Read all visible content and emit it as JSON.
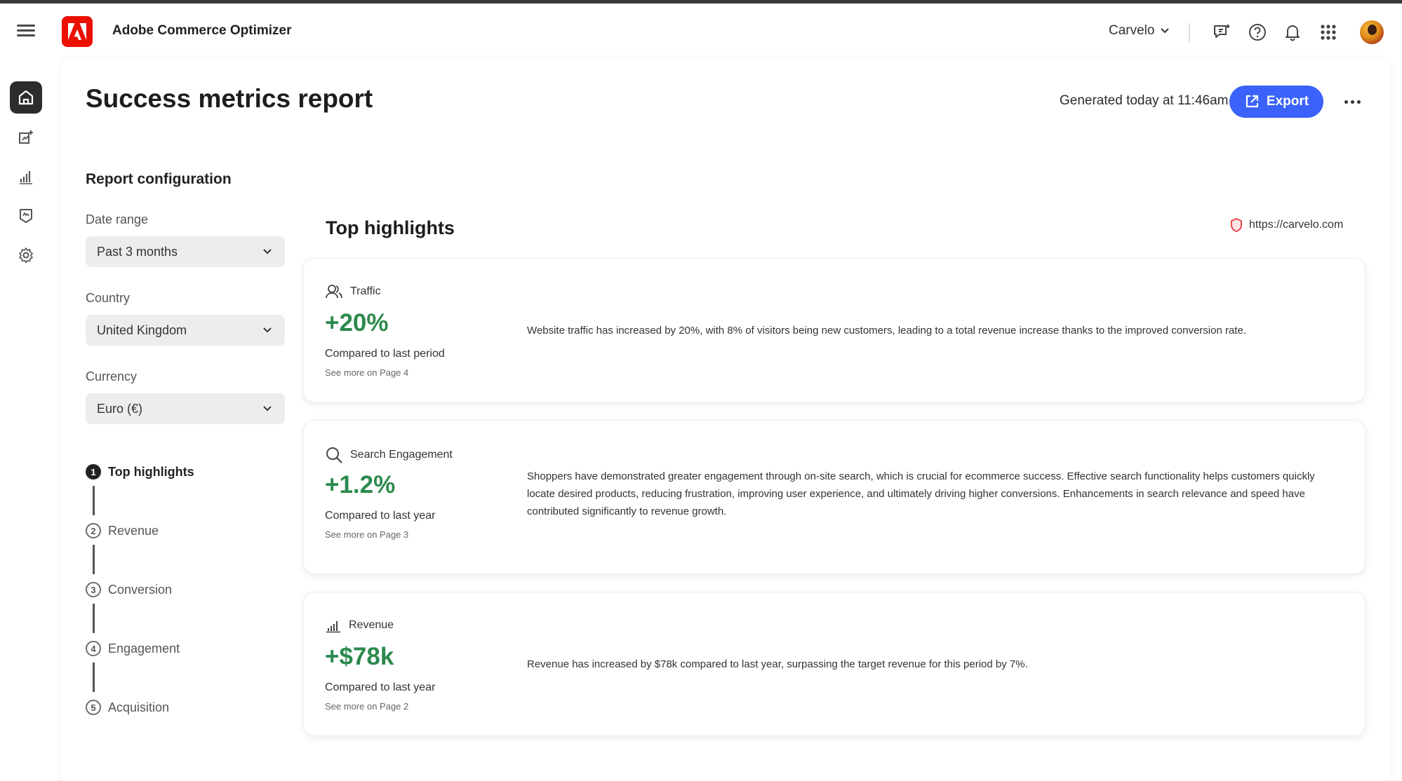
{
  "app": {
    "title": "Adobe Commerce Optimizer",
    "org": "Carvelo"
  },
  "page": {
    "title": "Success metrics report",
    "generated": "Generated today at 11:46am",
    "export_label": "Export"
  },
  "config": {
    "title": "Report configuration",
    "fields": [
      {
        "label": "Date range",
        "value": "Past 3 months"
      },
      {
        "label": "Country",
        "value": "United Kingdom"
      },
      {
        "label": "Currency",
        "value": "Euro (€)"
      }
    ]
  },
  "steps": [
    {
      "num": "1",
      "label": "Top highlights",
      "active": true
    },
    {
      "num": "2",
      "label": "Revenue"
    },
    {
      "num": "3",
      "label": "Conversion"
    },
    {
      "num": "4",
      "label": "Engagement"
    },
    {
      "num": "5",
      "label": "Acquisition"
    }
  ],
  "highlights": {
    "title": "Top highlights",
    "site_url": "https://carvelo.com",
    "cards": [
      {
        "label": "Traffic",
        "icon": "users-icon",
        "metric": "+20%",
        "comparison": "Compared to last period",
        "see_more": "See more on Page 4",
        "description": "Website traffic has increased by 20%, with 8% of visitors being new customers, leading to a total revenue increase thanks to the improved conversion rate."
      },
      {
        "label": "Search Engagement",
        "icon": "search-icon",
        "metric": "+1.2%",
        "comparison": "Compared to last year",
        "see_more": "See more on Page 3",
        "description": "Shoppers have demonstrated greater engagement through on-site search, which is crucial for ecommerce success. Effective search functionality helps customers quickly locate desired products, reducing frustration, improving user experience, and ultimately driving higher conversions. Enhancements in search relevance and speed have contributed significantly to revenue growth."
      },
      {
        "label": "Revenue",
        "icon": "bar-chart-icon",
        "metric": "+$78k",
        "comparison": "Compared to last year",
        "see_more": "See more on Page 2",
        "description": "Revenue has increased by $78k compared to last year, surpassing the target revenue for this period by 7%."
      }
    ]
  },
  "colors": {
    "accent": "#3b63fb",
    "positive": "#2d8a4e",
    "brand": "#eb1000"
  }
}
